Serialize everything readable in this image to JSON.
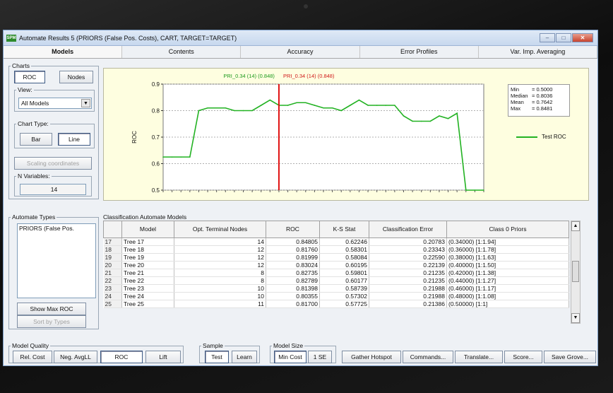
{
  "window": {
    "title": "Automate Results 5 (PRIORS (False Pos. Costs), CART, TARGET=TARGET)",
    "tabs": [
      "Models",
      "Contents",
      "Accuracy",
      "Error Profiles",
      "Var. Imp. Averaging"
    ],
    "active_tab": "Models"
  },
  "charts_group": {
    "legend": "Charts",
    "roc_button": "ROC",
    "nodes_button": "Nodes",
    "view_legend": "View:",
    "view_value": "All Models",
    "chart_type_legend": "Chart Type:",
    "bar_button": "Bar",
    "line_button": "Line",
    "scaling_button": "Scaling coordinates",
    "nvars_legend": "N Variables:",
    "nvars_value": "14"
  },
  "chart_data": {
    "type": "line",
    "title": "",
    "xlabel": "",
    "ylabel": "ROC",
    "ylim": [
      0.5,
      0.9
    ],
    "yticks": [
      "0.9",
      "0.8",
      "0.7",
      "0.6",
      "0.5"
    ],
    "header_green_1": "PRI_0.34 (14) (0.848)",
    "header_red": "PRI_0.34 (14) (0.848)",
    "header_green_2": "(0.848)",
    "marker_x": 13,
    "series": [
      {
        "name": "Test ROC",
        "color": "#22b222",
        "values": [
          0.625,
          0.625,
          0.625,
          0.625,
          0.8,
          0.81,
          0.81,
          0.81,
          0.8,
          0.8,
          0.8,
          0.82,
          0.84,
          0.82,
          0.82,
          0.83,
          0.83,
          0.82,
          0.81,
          0.81,
          0.8,
          0.82,
          0.84,
          0.82,
          0.82,
          0.82,
          0.82,
          0.78,
          0.76,
          0.76,
          0.76,
          0.78,
          0.77,
          0.79,
          0.5,
          0.5,
          0.5
        ]
      }
    ],
    "stats": [
      {
        "label": "Min",
        "value": "= 0.5000"
      },
      {
        "label": "Median",
        "value": "= 0.8036"
      },
      {
        "label": "Mean",
        "value": "= 0.7642"
      },
      {
        "label": "Max",
        "value": "= 0.8481"
      }
    ],
    "legend_label": "Test ROC",
    "grid": true,
    "colors": {
      "line": "#22b222",
      "marker": "#e01010",
      "background": "#fefee0"
    }
  },
  "automate_types": {
    "legend": "Automate Types",
    "items": [
      "PRIORS (False Pos."
    ],
    "show_max_roc": "Show Max ROC",
    "sort_by_types": "Sort by Types"
  },
  "models_table": {
    "caption": "Classification Automate Models",
    "headers": [
      "",
      "Model",
      "Opt. Terminal Nodes",
      "ROC",
      "K-S Stat",
      "Classification Error",
      "Class 0 Priors"
    ],
    "rows": [
      [
        "17",
        "Tree 17",
        "14",
        "0.84805",
        "0.62246",
        "0.20783",
        "(0.34000) [1:1.94]"
      ],
      [
        "18",
        "Tree 18",
        "12",
        "0.81760",
        "0.58301",
        "0.23343",
        "(0.36000) [1:1.78]"
      ],
      [
        "19",
        "Tree 19",
        "12",
        "0.81999",
        "0.58084",
        "0.22590",
        "(0.38000) [1:1.63]"
      ],
      [
        "20",
        "Tree 20",
        "12",
        "0.83024",
        "0.60195",
        "0.22139",
        "(0.40000) [1:1.50]"
      ],
      [
        "21",
        "Tree 21",
        "8",
        "0.82735",
        "0.59801",
        "0.21235",
        "(0.42000) [1:1.38]"
      ],
      [
        "22",
        "Tree 22",
        "8",
        "0.82789",
        "0.60177",
        "0.21235",
        "(0.44000) [1:1.27]"
      ],
      [
        "23",
        "Tree 23",
        "10",
        "0.81398",
        "0.58739",
        "0.21988",
        "(0.46000) [1:1.17]"
      ],
      [
        "24",
        "Tree 24",
        "10",
        "0.80355",
        "0.57302",
        "0.21988",
        "(0.48000) [1:1.08]"
      ],
      [
        "25",
        "Tree 25",
        "11",
        "0.81700",
        "0.57725",
        "0.21386",
        "(0.50000) [1:1]"
      ]
    ]
  },
  "model_quality": {
    "legend": "Model Quality",
    "buttons": [
      "Rel. Cost",
      "Neg. AvgLL",
      "ROC",
      "Lift"
    ]
  },
  "sample": {
    "legend": "Sample",
    "buttons": [
      "Test",
      "Learn"
    ]
  },
  "model_size": {
    "legend": "Model Size",
    "buttons": [
      "Min Cost",
      "1 SE"
    ]
  },
  "actions": [
    "Gather Hotspot",
    "Commands...",
    "Translate...",
    "Score...",
    "Save Grove..."
  ]
}
